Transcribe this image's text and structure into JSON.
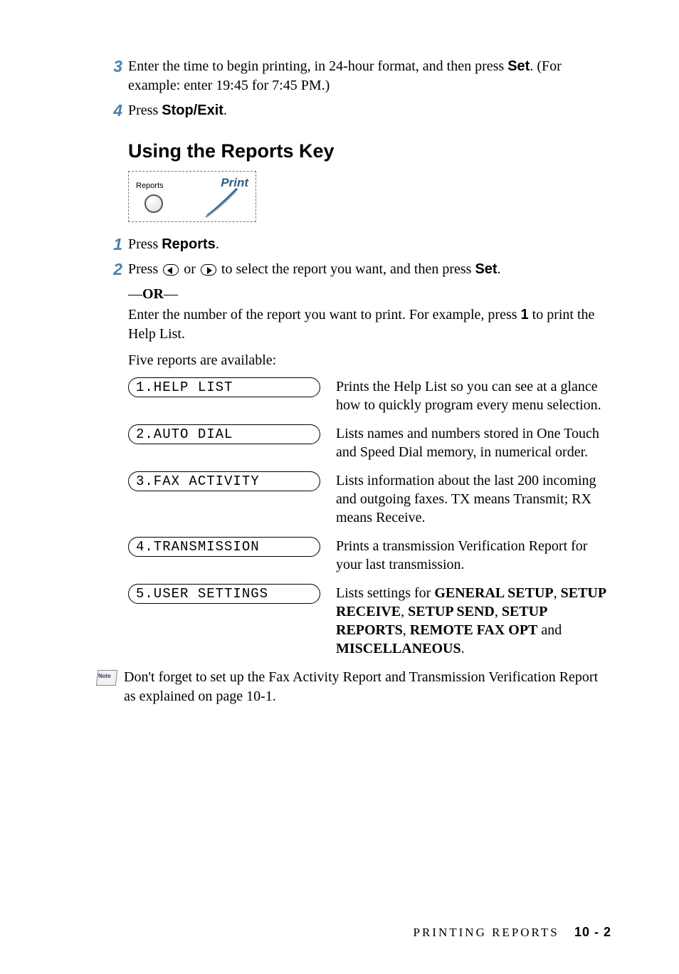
{
  "steps_top": [
    {
      "num": "3",
      "pre": "Enter the time to begin printing, in 24-hour format, and then press ",
      "bold": "Set",
      "post": ". (For example: enter 19:45 for 7:45 PM.)"
    },
    {
      "num": "4",
      "pre": "Press ",
      "bold": "Stop/Exit",
      "post": "."
    }
  ],
  "section_title": "Using the Reports Key",
  "btn": {
    "label": "Reports",
    "print": "Print"
  },
  "steps_mid": {
    "s1": {
      "num": "1",
      "pre": "Press ",
      "bold": "Reports",
      "post": "."
    },
    "s2": {
      "num": "2",
      "pre": "Press ",
      "mid": " or ",
      "post_pre": " to select the report you want, and then press ",
      "bold": "Set",
      "post": "."
    }
  },
  "or_line": {
    "dash1": "—",
    "or": "OR",
    "dash2": "—"
  },
  "enter_num": {
    "pre": "Enter the number of the report you want to print. For example, press ",
    "bold": "1",
    "post": " to print the Help List."
  },
  "five_line": "Five reports are available:",
  "reports": [
    {
      "lcd": "1.HELP LIST",
      "desc_plain": "Prints the Help List so you can see at a glance how to quickly program every menu selection."
    },
    {
      "lcd": "2.AUTO DIAL",
      "desc_plain": "Lists names and numbers stored in One Touch and Speed Dial memory, in numerical order."
    },
    {
      "lcd": "3.FAX ACTIVITY",
      "desc_plain": "Lists information about the last 200 incoming and outgoing faxes. TX means Transmit; RX means Receive."
    },
    {
      "lcd": "4.TRANSMISSION",
      "desc_plain": "Prints a transmission Verification Report for your last transmission."
    },
    {
      "lcd": "5.USER SETTINGS",
      "desc_pre": "Lists settings for ",
      "bold_parts": [
        "GENERAL SETUP",
        "SETUP RECEIVE",
        "SETUP SEND",
        "SETUP REPORTS",
        "REMOTE FAX OPT",
        "MISCELLANEOUS"
      ],
      "joiners": [
        ", ",
        ", ",
        ", ",
        ", ",
        " and ",
        "."
      ]
    }
  ],
  "note": {
    "label": "Note",
    "text": "Don't forget to set up the Fax Activity Report and Transmission Verification Report as explained on page 10-1."
  },
  "footer": {
    "section": "PRINTING REPORTS",
    "page": "10 - 2"
  }
}
